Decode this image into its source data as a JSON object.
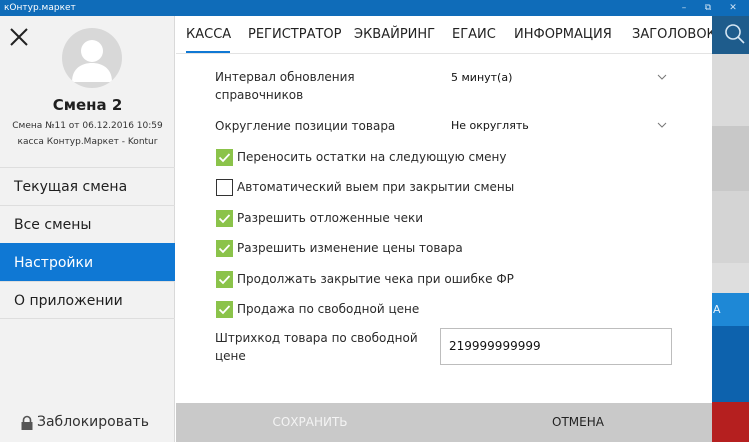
{
  "window": {
    "title": "кОнтур.маркет",
    "controls": {
      "minimize": "–",
      "maximize": "⧉",
      "close": "✕"
    }
  },
  "sidebar": {
    "shift_title": "Смена 2",
    "shift_info": "Смена №11 от 06.12.2016 10:59",
    "register_info": "касса Контур.Маркет - Kontur",
    "items": [
      {
        "label": "Текущая смена"
      },
      {
        "label": "Все смены"
      },
      {
        "label": "Настройки",
        "selected": true
      },
      {
        "label": "О приложении"
      }
    ],
    "lock_label": "Заблокировать"
  },
  "tabs": [
    {
      "label": "КАССА",
      "active": true
    },
    {
      "label": "РЕГИСТРАТОР"
    },
    {
      "label": "ЭКВАЙРИНГ"
    },
    {
      "label": "ЕГАИС"
    },
    {
      "label": "ИНФОРМАЦИЯ"
    },
    {
      "label": "ЗАГОЛОВОК"
    }
  ],
  "settings": {
    "refresh_interval": {
      "label_line1": "Интервал обновления",
      "label_line2": "справочников",
      "value": "5 минут(а)"
    },
    "rounding": {
      "label": "Округление позиции товара",
      "value": "Не округлять"
    },
    "checkboxes": [
      {
        "label": "Переносить остатки на следующую смену",
        "checked": true
      },
      {
        "label": "Автоматический выем при закрытии смены",
        "checked": false
      },
      {
        "label": "Разрешить отложенные чеки",
        "checked": true
      },
      {
        "label": "Разрешить изменение цены товара",
        "checked": true
      },
      {
        "label": "Продолжать закрытие чека при ошибке ФР",
        "checked": true
      },
      {
        "label": "Продажа по свободной цене",
        "checked": true
      }
    ],
    "barcode": {
      "label_line1": "Штрихкод товара по свободной",
      "label_line2": "цене",
      "value": "219999999999"
    }
  },
  "background_strip": {
    "partial_text": "А"
  },
  "buttons": {
    "save": "СОХРАНИТЬ",
    "cancel": "ОТМЕНА"
  },
  "colors": {
    "accent": "#0f78d4",
    "check": "#8bc34a",
    "danger": "#b51f1f"
  }
}
